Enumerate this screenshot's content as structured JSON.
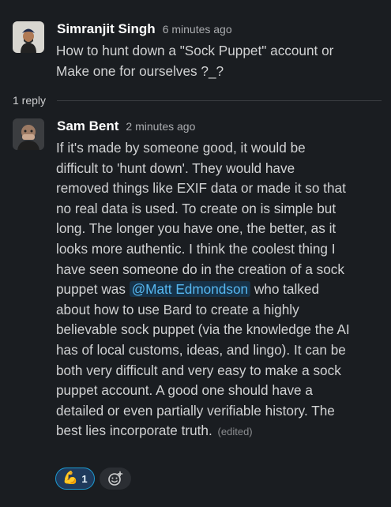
{
  "messages": [
    {
      "author": "Simranjit Singh",
      "time": "6 minutes ago",
      "lines": [
        "How to hunt down a \"Sock Puppet\" account or",
        "Make one for ourselves ?_?"
      ]
    },
    {
      "author": "Sam Bent",
      "time": "2 minutes ago",
      "lines": [
        "If it's made by someone good, it would be",
        "difficult to 'hunt down'. They would have",
        "removed things like EXIF data or made it so that",
        "no real data is used. To create on is simple but",
        "long. The longer you have one, the better, as it",
        "looks more authentic.  I think the coolest thing I",
        "have seen someone do in the creation of a sock"
      ],
      "mention_prefix": "puppet was ",
      "mention": "@Matt Edmondson",
      "mention_suffix": " who talked",
      "lines_after": [
        "about how to use Bard to create a highly",
        "believable sock puppet (via the knowledge the AI",
        "has of local customs, ideas, and lingo). It can be",
        "both very difficult and very easy to make a sock",
        "puppet account. A good one should have a",
        "detailed or even partially verifiable history. The"
      ],
      "last_line": "best lies incorporate truth.",
      "edited": "(edited)"
    }
  ],
  "thread": {
    "reply_count": "1 reply"
  },
  "reactions": [
    {
      "emoji": "💪",
      "count": "1",
      "icon": "flexed-biceps-emoji"
    }
  ],
  "icons": {
    "add_reaction": "add-reaction-icon"
  },
  "colors": {
    "background": "#1a1d21",
    "mention": "#56b7f0",
    "reaction_border": "#1d9bd1"
  }
}
